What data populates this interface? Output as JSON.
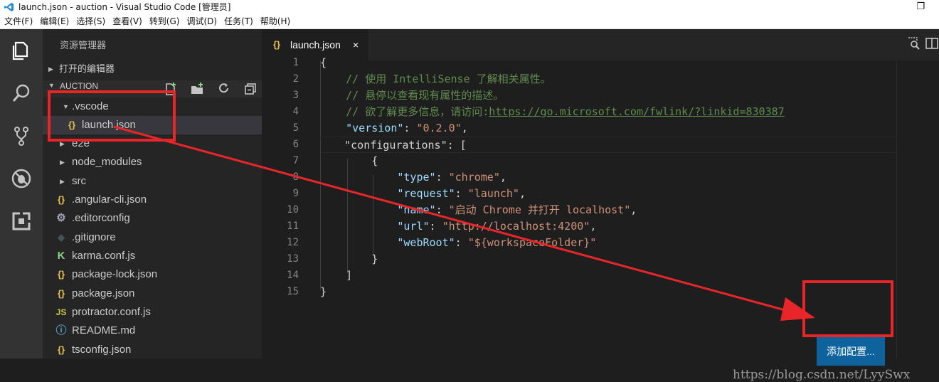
{
  "window": {
    "title": "launch.json - auction - Visual Studio Code [管理员]"
  },
  "menu": [
    "文件(F)",
    "编辑(E)",
    "选择(S)",
    "查看(V)",
    "转到(G)",
    "调试(D)",
    "任务(T)",
    "帮助(H)"
  ],
  "activity_bar": [
    "files-icon",
    "search-icon",
    "source-control-icon",
    "debug-icon",
    "extensions-icon"
  ],
  "sidebar": {
    "title": "资源管理器",
    "open_editors": "打开的编辑器",
    "project": "AUCTION",
    "tree": [
      {
        "label": ".vscode",
        "type": "folder-open",
        "icon": ""
      },
      {
        "label": "launch.json",
        "type": "json",
        "icon": "{}"
      },
      {
        "label": "e2e",
        "type": "folder",
        "icon": ""
      },
      {
        "label": "node_modules",
        "type": "folder",
        "icon": ""
      },
      {
        "label": "src",
        "type": "folder",
        "icon": ""
      },
      {
        "label": ".angular-cli.json",
        "type": "json",
        "icon": "{}"
      },
      {
        "label": ".editorconfig",
        "type": "gear",
        "icon": "⚙"
      },
      {
        "label": ".gitignore",
        "type": "git",
        "icon": "◆"
      },
      {
        "label": "karma.conf.js",
        "type": "karma",
        "icon": "K"
      },
      {
        "label": "package-lock.json",
        "type": "json",
        "icon": "{}"
      },
      {
        "label": "package.json",
        "type": "json",
        "icon": "{}"
      },
      {
        "label": "protractor.conf.js",
        "type": "js",
        "icon": "JS"
      },
      {
        "label": "README.md",
        "type": "info",
        "icon": "ⓘ"
      },
      {
        "label": "tsconfig.json",
        "type": "json",
        "icon": "{}"
      }
    ]
  },
  "editor": {
    "tab": {
      "icon": "{}",
      "label": "launch.json",
      "close": "×"
    },
    "lines": [
      "{",
      "    // 使用 IntelliSense 了解相关属性。",
      "    // 悬停以查看现有属性的描述。",
      "    // 欲了解更多信息，请访问:",
      "    \"version\": \"0.2.0\",",
      "    \"configurations\": [",
      "        {",
      "            \"type\": \"chrome\",",
      "            \"request\": \"launch\",",
      "            \"name\": \"启动 Chrome 并打开 localhost\",",
      "            \"url\": \"http://localhost:4200\",",
      "            \"webRoot\": \"${workspaceFolder}\"",
      "        }",
      "    ]",
      "}"
    ],
    "comment_url": "https://go.microsoft.com/fwlink/?linkid=830387",
    "line_numbers": [
      "1",
      "2",
      "3",
      "4",
      "5",
      "6",
      "7",
      "8",
      "9",
      "10",
      "11",
      "12",
      "13",
      "14",
      "15"
    ],
    "add_config_button": "添加配置..."
  },
  "watermark": "https://blog.csdn.net/LyySwx",
  "colors": {
    "accent_button": "#0e639c",
    "annotation_red": "#e8262a",
    "json_icon": "#e8c351"
  }
}
